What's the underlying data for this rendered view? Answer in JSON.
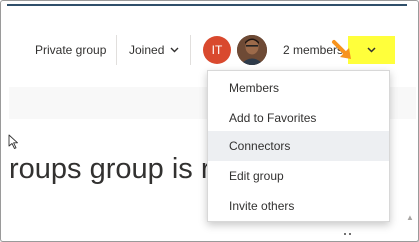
{
  "header": {
    "privacy_label": "Private group",
    "joined_label": "Joined",
    "avatar_initials": "IT",
    "members_count": "2 members"
  },
  "menu": {
    "items": [
      {
        "label": "Members",
        "active": false
      },
      {
        "label": "Add to Favorites",
        "active": false
      },
      {
        "label": "Connectors",
        "active": true
      },
      {
        "label": "Edit group",
        "active": false
      },
      {
        "label": "Invite others",
        "active": false
      }
    ]
  },
  "content": {
    "heading_fragment": "roups group is re"
  },
  "colors": {
    "highlight": "#ffff3b",
    "arrow": "#f7931e",
    "avatar_bg": "#d9492e",
    "menu_active_bg": "#edeff2"
  },
  "icons": [
    "chevron-down-icon",
    "arrow-pointer-icon",
    "mouse-cursor-icon"
  ]
}
